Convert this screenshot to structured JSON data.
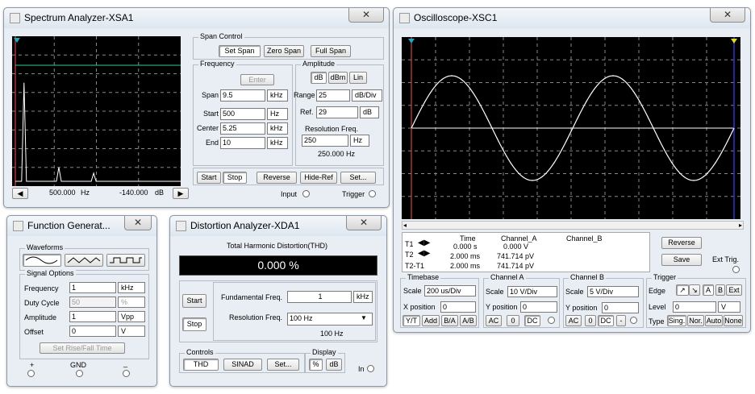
{
  "spectrum": {
    "title": "Spectrum Analyzer-XSA1",
    "close": "✕",
    "readout": {
      "freq": "500.000",
      "freq_unit": "Hz",
      "level": "-140.000",
      "level_unit": "dB"
    },
    "span_control": {
      "label": "Span Control",
      "set_span": "Set Span",
      "zero_span": "Zero Span",
      "full_span": "Full Span"
    },
    "frequency": {
      "label": "Frequency",
      "enter": "Enter",
      "span_label": "Span",
      "span_value": "9.5",
      "span_unit": "kHz",
      "start_label": "Start",
      "start_value": "500",
      "start_unit": "Hz",
      "center_label": "Center",
      "center_value": "5.25",
      "center_unit": "kHz",
      "end_label": "End",
      "end_value": "10",
      "end_unit": "kHz"
    },
    "amplitude": {
      "label": "Amplitude",
      "db": "dB",
      "dbm": "dBm",
      "lin": "Lin",
      "range_label": "Range",
      "range_value": "25",
      "range_unit": "dB/Div",
      "ref_label": "Ref.",
      "ref_value": "29",
      "ref_unit": "dB"
    },
    "resolution": {
      "label": "Resolution Freq.",
      "value": "250",
      "unit": "Hz",
      "display": "250.000  Hz"
    },
    "buttons": {
      "start": "Start",
      "stop": "Stop",
      "reverse": "Reverse",
      "hide_ref": "Hide-Ref",
      "set": "Set..."
    },
    "input_label": "Input",
    "trigger_label": "Trigger",
    "spectrum_peaks": [
      {
        "freq_hz": 1000,
        "rel": 0.85
      },
      {
        "freq_hz": 3000,
        "rel": 0.12
      },
      {
        "freq_hz": 5000,
        "rel": 0.07
      }
    ]
  },
  "oscilloscope": {
    "title": "Oscilloscope-XSC1",
    "close": "✕",
    "signal": {
      "periods": 2,
      "amplitude_div": 2.3
    },
    "readout": {
      "headers": [
        "Time",
        "Channel_A",
        "Channel_B"
      ],
      "rows": [
        {
          "label": "T1",
          "time": "0.000 s",
          "cha": "0.000 V",
          "chb": ""
        },
        {
          "label": "T2",
          "time": "2.000 ms",
          "cha": "741.714 pV",
          "chb": ""
        },
        {
          "label": "T2-T1",
          "time": "2.000 ms",
          "cha": "741.714 pV",
          "chb": ""
        }
      ]
    },
    "reverse": "Reverse",
    "save": "Save",
    "ext_trig": "Ext Trig.",
    "timebase": {
      "label": "Timebase",
      "scale_label": "Scale",
      "scale_value": "200 us/Div",
      "xpos_label": "X position",
      "xpos_value": "0",
      "yt": "Y/T",
      "add": "Add",
      "ba": "B/A",
      "ab": "A/B"
    },
    "channel_a": {
      "label": "Channel A",
      "scale_label": "Scale",
      "scale_value": "10  V/Div",
      "ypos_label": "Y position",
      "ypos_value": "0",
      "ac": "AC",
      "zero": "0",
      "dc": "DC"
    },
    "channel_b": {
      "label": "Channel B",
      "scale_label": "Scale",
      "scale_value": "5  V/Div",
      "ypos_label": "Y position",
      "ypos_value": "0",
      "ac": "AC",
      "zero": "0",
      "dc": "DC",
      "minus": "-"
    },
    "trigger": {
      "label": "Trigger",
      "edge_label": "Edge",
      "a": "A",
      "b": "B",
      "ext": "Ext",
      "level_label": "Level",
      "level_value": "0",
      "level_unit": "V",
      "type_label": "Type",
      "sing": "Sing.",
      "nor": "Nor.",
      "auto": "Auto",
      "none": "None"
    }
  },
  "function_gen": {
    "title": "Function Generat...",
    "close": "✕",
    "waveforms_label": "Waveforms",
    "signal_options_label": "Signal Options",
    "frequency_label": "Frequency",
    "frequency_value": "1",
    "frequency_unit": "kHz",
    "duty_label": "Duty Cycle",
    "duty_value": "50",
    "duty_unit": "%",
    "amplitude_label": "Amplitude",
    "amplitude_value": "1",
    "amplitude_unit": "Vpp",
    "offset_label": "Offset",
    "offset_value": "0",
    "offset_unit": "V",
    "set_rise_fall": "Set Rise/Fall Time",
    "plus": "+",
    "gnd": "GND",
    "minus": "_"
  },
  "distortion": {
    "title": "Distortion Analyzer-XDA1",
    "close": "✕",
    "thd_label": "Total Harmonic Distortion(THD)",
    "display_value": "0.000 %",
    "start": "Start",
    "stop": "Stop",
    "fund_label": "Fundamental Freq.",
    "fund_value": "1",
    "fund_unit": "kHz",
    "res_label": "Resolution Freq.",
    "res_value": "100 Hz",
    "res_display": "100 Hz",
    "controls_label": "Controls",
    "thd": "THD",
    "sinad": "SINAD",
    "set": "Set...",
    "display_label": "Display",
    "pct": "%",
    "db": "dB",
    "in_label": "In"
  }
}
